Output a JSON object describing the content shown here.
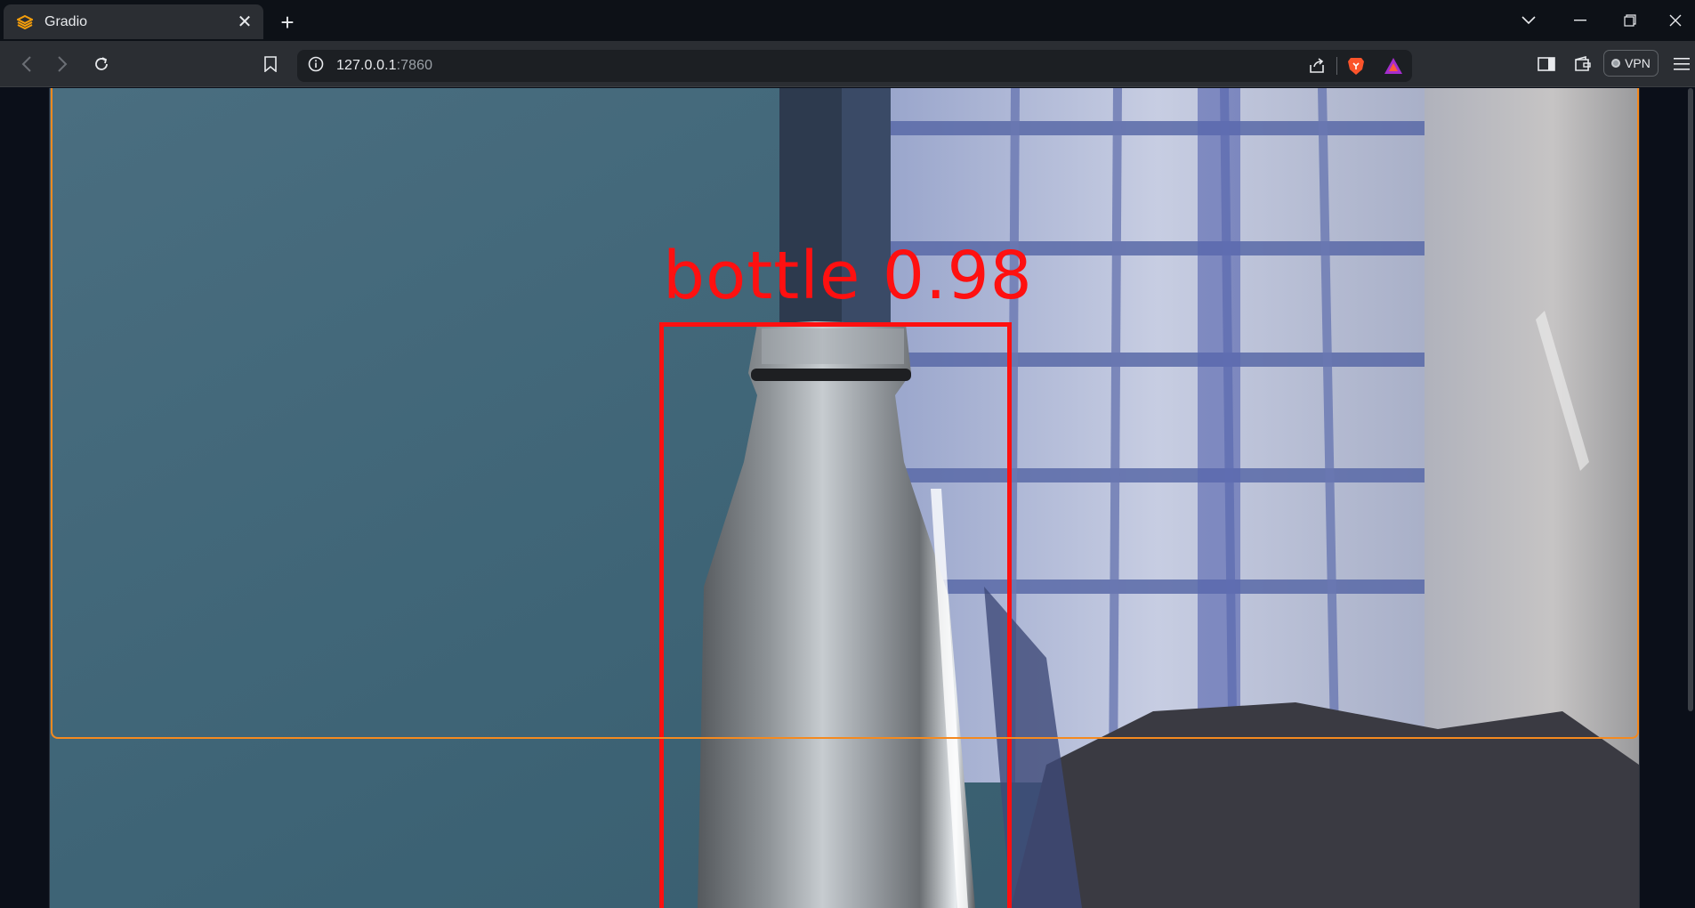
{
  "browser": {
    "tab": {
      "title": "Gradio",
      "favicon": "gradio-logo-icon",
      "close_glyph": "✕"
    },
    "new_tab_glyph": "+",
    "address": {
      "host": "127.0.0.1",
      "port": ":7860",
      "info_icon": "info-icon"
    },
    "vpn_label": "VPN",
    "window_controls": [
      "tab-search-icon",
      "minimize-icon",
      "restore-icon",
      "close-icon"
    ],
    "toolbar_icons": [
      "back-icon",
      "forward-icon",
      "reload-icon",
      "bookmark-icon",
      "share-icon",
      "brave-shield-icon",
      "brave-rewards-icon",
      "sidebar-icon",
      "wallet-icon",
      "menu-icon"
    ]
  },
  "detection": {
    "label": "bottle 0.98",
    "class": "bottle",
    "confidence": 0.98,
    "box_color": "#ff1010"
  },
  "colors": {
    "accent_border": "#f58a1f",
    "page_bg": "#0b0f19"
  }
}
